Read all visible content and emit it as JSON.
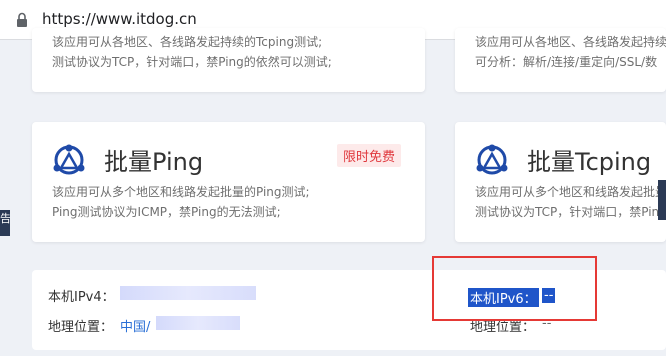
{
  "browser": {
    "url": "https://www.itdog.cn"
  },
  "top_cards": {
    "left": {
      "desc_line1": "该应用可从各地区、各线路发起持续的Tcping测试;",
      "desc_line2": "测试协议为TCP，针对端口，禁Ping的依然可以测试;"
    },
    "right": {
      "desc_line1": "该应用可从各地区、各线路发起持续的Tcping测试;",
      "desc_line2": "可分析：解析/连接/重定向/SSL/数"
    }
  },
  "tool_cards": [
    {
      "title": "批量Ping",
      "badge": "限时免费",
      "desc_line1": "该应用可从多个地区和线路发起批量的Ping测试;",
      "desc_line2": "Ping测试协议为ICMP，禁Ping的无法测试;"
    },
    {
      "title": "批量Tcping",
      "desc_line1": "该应用可从多个地区和线路发起批量的Tcping测试;",
      "desc_line2": "测试协议为TCP，针对端口，禁Ping"
    }
  ],
  "left_edge_mark": "告",
  "ip_info": {
    "ipv4_label": "本机IPv4：",
    "geo_label": "地理位置：",
    "geo_value_prefix": "中国/",
    "ipv6_label": "本机IPv6：",
    "ipv6_value": "--",
    "geo6_label": "地理位置：",
    "geo6_value": "--"
  },
  "colors": {
    "accent_red": "#e53935",
    "badge_red": "#e0393e",
    "link_blue": "#2a6fd6",
    "selection_blue": "#1f55c9"
  }
}
